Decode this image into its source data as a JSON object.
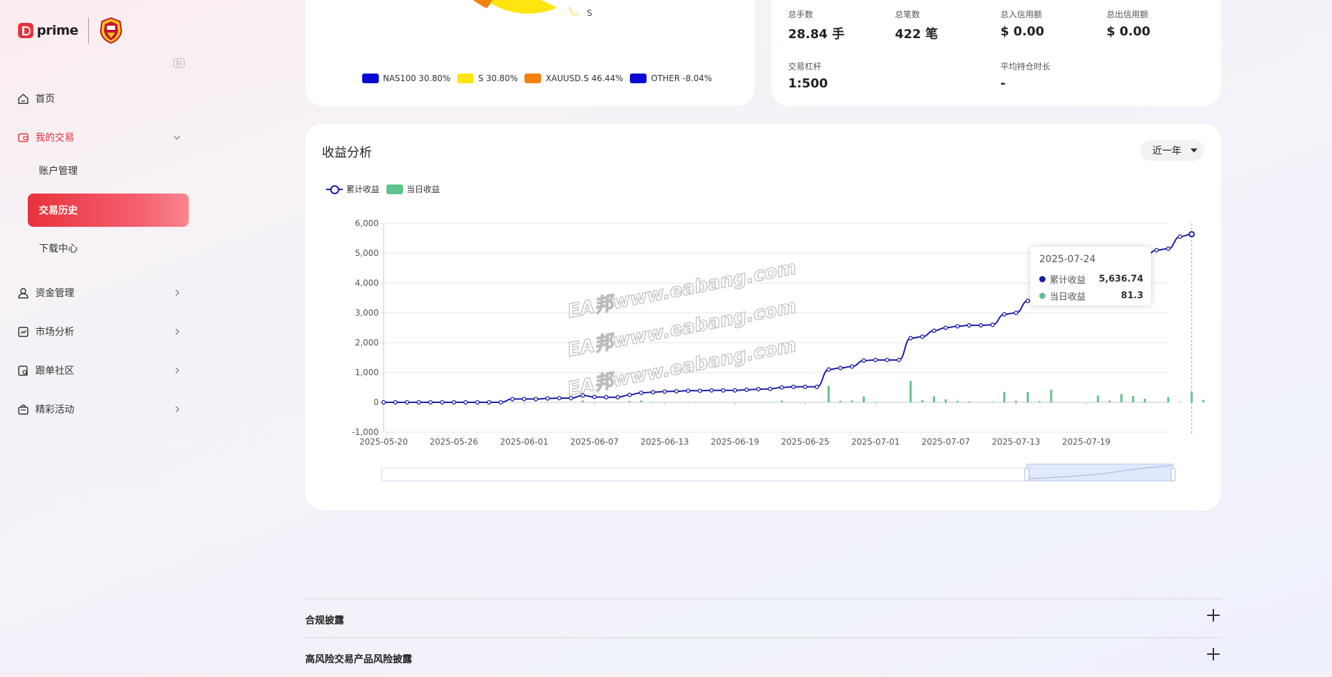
{
  "brand": {
    "logo_text": "prime"
  },
  "sidebar": {
    "items": [
      {
        "label": "首页",
        "icon": "home-icon"
      },
      {
        "label": "我的交易",
        "icon": "wallet-icon",
        "expanded": true
      },
      {
        "label": "资金管理",
        "icon": "user-money-icon"
      },
      {
        "label": "市场分析",
        "icon": "chart-report-icon"
      },
      {
        "label": "跟单社区",
        "icon": "people-search-icon"
      },
      {
        "label": "精彩活动",
        "icon": "gift-bag-icon"
      }
    ],
    "subitems": [
      {
        "label": "账户管理"
      },
      {
        "label": "交易历史",
        "selected": true
      },
      {
        "label": "下载中心"
      }
    ]
  },
  "pie": {
    "visible_label": "S",
    "legend": [
      {
        "label": "NAS100 30.80%",
        "color": "#0a0ad4"
      },
      {
        "label": "S 30.80%",
        "color": "#ffe510"
      },
      {
        "label": "XAUUSD.S 46.44%",
        "color": "#f5820f"
      },
      {
        "label": "OTHER -8.04%",
        "color": "#0a0ad4"
      }
    ]
  },
  "stats": {
    "total_lots_label": "总手数",
    "total_lots_value": "28.84 手",
    "total_trades_label": "总笔数",
    "total_trades_value": "422 笔",
    "credit_in_label": "总入信用额",
    "credit_in_value": "$ 0.00",
    "credit_out_label": "总出信用额",
    "credit_out_value": "$ 0.00",
    "leverage_label": "交易杠杆",
    "leverage_value": "1:500",
    "hold_label": "平均持仓时长",
    "hold_value": "-"
  },
  "profit": {
    "title": "收益分析",
    "range_label": "近一年",
    "legend_cumulative": "累计收益",
    "legend_daily": "当日收益",
    "tooltip": {
      "date": "2025-07-24",
      "cumulative_label": "累计收益",
      "cumulative_value": "5,636.74",
      "daily_label": "当日收益",
      "daily_value": "81.3"
    }
  },
  "chart_data": {
    "type": "line",
    "ylim": [
      -1000,
      6000
    ],
    "yticks": [
      "-1,000",
      "0",
      "1,000",
      "2,000",
      "3,000",
      "4,000",
      "5,000",
      "6,000"
    ],
    "xtick_labels": [
      "2025-05-20",
      "2025-05-26",
      "2025-06-01",
      "2025-06-07",
      "2025-06-13",
      "2025-06-19",
      "2025-06-25",
      "2025-07-01",
      "2025-07-07",
      "2025-07-13",
      "2025-07-19"
    ],
    "x_start": "2025-05-20",
    "x_end": "2025-07-26",
    "series": [
      {
        "name": "累计收益",
        "color": "#1a1aa6",
        "values": [
          0,
          0,
          0,
          0,
          0,
          0,
          0,
          0,
          0,
          0,
          0,
          110,
          110,
          110,
          130,
          140,
          140,
          230,
          180,
          170,
          170,
          250,
          320,
          340,
          360,
          370,
          390,
          390,
          400,
          400,
          400,
          420,
          440,
          450,
          500,
          520,
          520,
          520,
          1100,
          1150,
          1200,
          1400,
          1420,
          1420,
          1420,
          2150,
          2200,
          2400,
          2500,
          2550,
          2580,
          2580,
          2600,
          2950,
          3000,
          3400,
          3450,
          3900,
          3900,
          3900,
          4000,
          4050,
          4100,
          4300,
          4600,
          4900,
          5100,
          5150,
          5555,
          5636.74
        ]
      },
      {
        "name": "当日收益",
        "color": "#5ec28b",
        "values": [
          0,
          0,
          0,
          0,
          0,
          0,
          0,
          0,
          0,
          0,
          0,
          20,
          0,
          0,
          10,
          5,
          0,
          60,
          15,
          5,
          0,
          40,
          60,
          20,
          10,
          5,
          20,
          0,
          5,
          0,
          0,
          10,
          10,
          5,
          60,
          10,
          0,
          0,
          550,
          50,
          60,
          200,
          10,
          0,
          0,
          720,
          70,
          200,
          100,
          50,
          30,
          0,
          20,
          350,
          50,
          340,
          40,
          420,
          0,
          0,
          0,
          230,
          60,
          280,
          210,
          120,
          0,
          180,
          20,
          340,
          81.3
        ]
      }
    ]
  },
  "disclosures": [
    {
      "label": "合规披露"
    },
    {
      "label": "高风险交易产品风险披露"
    }
  ],
  "watermark": {
    "text": "EA邦www.eabang.com"
  }
}
